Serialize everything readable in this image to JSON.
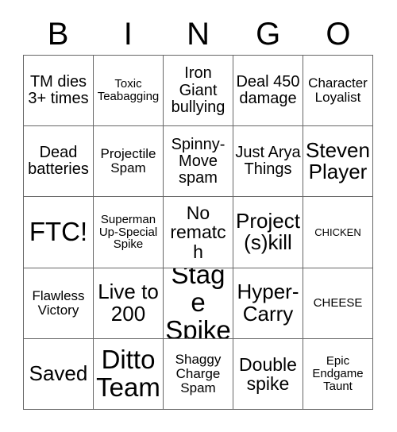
{
  "card": {
    "type": "bingo-card",
    "background_color": "#ffffff",
    "text_color": "#000000",
    "border_color": "#666666",
    "header_letters": [
      "B",
      "I",
      "N",
      "G",
      "O"
    ],
    "grid_size": {
      "columns": 5,
      "rows": 5
    },
    "rows": [
      [
        {
          "text": "TM dies 3+ times",
          "size": "md"
        },
        {
          "text": "Toxic Teabagging",
          "size": "xs"
        },
        {
          "text": "Iron Giant bullying",
          "size": "md"
        },
        {
          "text": "Deal 450 damage",
          "size": "md"
        },
        {
          "text": "Character Loyalist",
          "size": "sm"
        }
      ],
      [
        {
          "text": "Dead batteries",
          "size": "md"
        },
        {
          "text": "Projectile Spam",
          "size": "sm"
        },
        {
          "text": "Spinny-Move spam",
          "size": "md"
        },
        {
          "text": "Just Arya Things",
          "size": "md"
        },
        {
          "text": "Steven Player",
          "size": "xl"
        }
      ],
      [
        {
          "text": "FTC!",
          "size": "xxl"
        },
        {
          "text": "Superman Up-Special Spike",
          "size": "xs"
        },
        {
          "text": "No rematch",
          "size": "lg"
        },
        {
          "text": "Project (s)kill",
          "size": "xl"
        },
        {
          "text": "CHICKEN",
          "size": "xxs"
        }
      ],
      [
        {
          "text": "Flawless Victory",
          "size": "sm"
        },
        {
          "text": "Live to 200",
          "size": "xl"
        },
        {
          "text": "Stage Spike",
          "size": "xxl"
        },
        {
          "text": "Hyper-Carry",
          "size": "xl"
        },
        {
          "text": "CHEESE",
          "size": "xs"
        }
      ],
      [
        {
          "text": "Saved",
          "size": "xl"
        },
        {
          "text": "Ditto Team",
          "size": "xxl"
        },
        {
          "text": "Shaggy Charge Spam",
          "size": "sm"
        },
        {
          "text": "Double spike",
          "size": "lg"
        },
        {
          "text": "Epic Endgame Taunt",
          "size": "xs"
        }
      ]
    ]
  }
}
